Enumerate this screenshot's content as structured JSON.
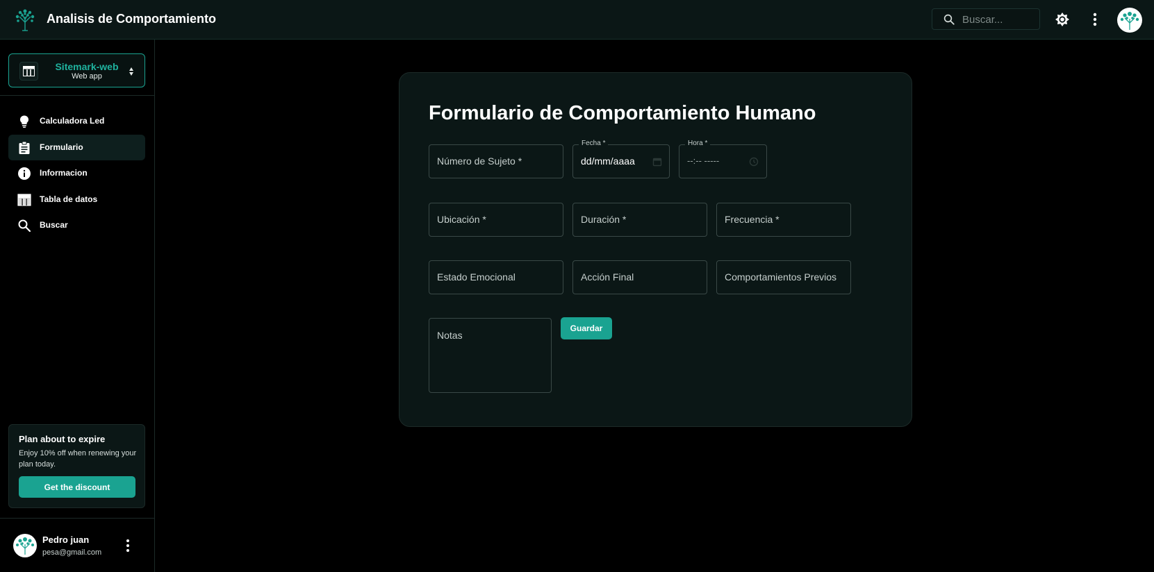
{
  "appbar": {
    "title": "Analisis de Comportamiento",
    "search_placeholder": "Buscar...",
    "logo_icon": "tree-logo-icon",
    "theme_icon": "brightness-icon",
    "more_icon": "more-vert-icon"
  },
  "sidebar": {
    "project": {
      "name": "Sitemark-web",
      "subtitle": "Web app"
    },
    "items": [
      {
        "label": "Calculadora Led",
        "icon": "lightbulb-icon"
      },
      {
        "label": "Formulario",
        "icon": "clipboard-icon"
      },
      {
        "label": "Informacion",
        "icon": "info-icon"
      },
      {
        "label": "Tabla de datos",
        "icon": "table-icon"
      },
      {
        "label": "Buscar",
        "icon": "search-icon"
      }
    ],
    "active_item": "Formulario",
    "promo": {
      "title": "Plan about to expire",
      "text": "Enjoy 10% off when renewing your plan today.",
      "button": "Get the discount"
    },
    "user": {
      "name": "Pedro juan",
      "email": "pesa@gmail.com"
    }
  },
  "form": {
    "title": "Formulario de Comportamiento Humano",
    "fields": {
      "sujeto": "Número de Sujeto *",
      "fecha_label": "Fecha *",
      "fecha_value": "dd/mm/aaaa",
      "hora_label": "Hora *",
      "hora_value": "--:-- -----",
      "ubicacion": "Ubicación *",
      "duracion": "Duración *",
      "frecuencia": "Frecuencia *",
      "estado": "Estado Emocional",
      "accion": "Acción Final",
      "previos": "Comportamientos Previos",
      "notas": "Notas"
    },
    "save_label": "Guardar"
  },
  "colors": {
    "accent": "#1aa391",
    "background": "#000000",
    "surface": "#0b1716"
  }
}
